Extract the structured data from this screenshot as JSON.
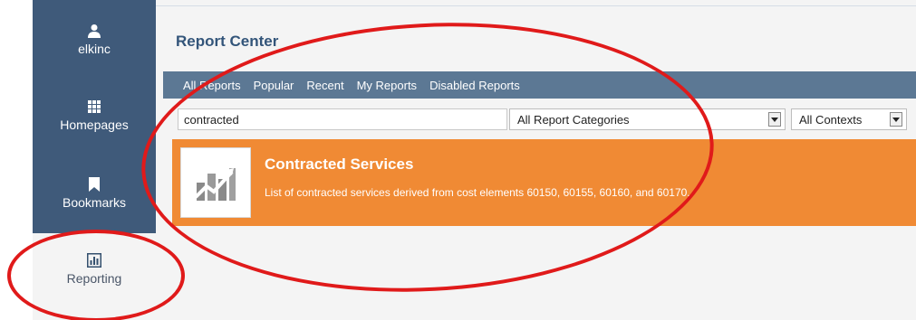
{
  "sidebar": {
    "user": {
      "label": "elkinc",
      "icon": "user-icon"
    },
    "homepages": {
      "label": "Homepages",
      "icon": "grid-icon"
    },
    "bookmarks": {
      "label": "Bookmarks",
      "icon": "bookmark-icon"
    },
    "reporting": {
      "label": "Reporting",
      "icon": "bar-chart-icon"
    }
  },
  "header": {
    "title": "Report Center"
  },
  "tabs": [
    "All Reports",
    "Popular",
    "Recent",
    "My Reports",
    "Disabled Reports"
  ],
  "filters": {
    "search_value": "contracted",
    "category_selected": "All Report Categories",
    "context_selected": "All Contexts"
  },
  "report": {
    "title": "Contracted Services",
    "description": "List of contracted services derived from cost elements 60150, 60155, 60160, and 60170.",
    "icon": "chart-thumbnail-icon"
  },
  "colors": {
    "sidebar_bg": "#3f5a7a",
    "tabbar_bg": "#5c7894",
    "card_bg": "#f08a34",
    "title_color": "#33557a",
    "annotation": "#e01a1a"
  }
}
